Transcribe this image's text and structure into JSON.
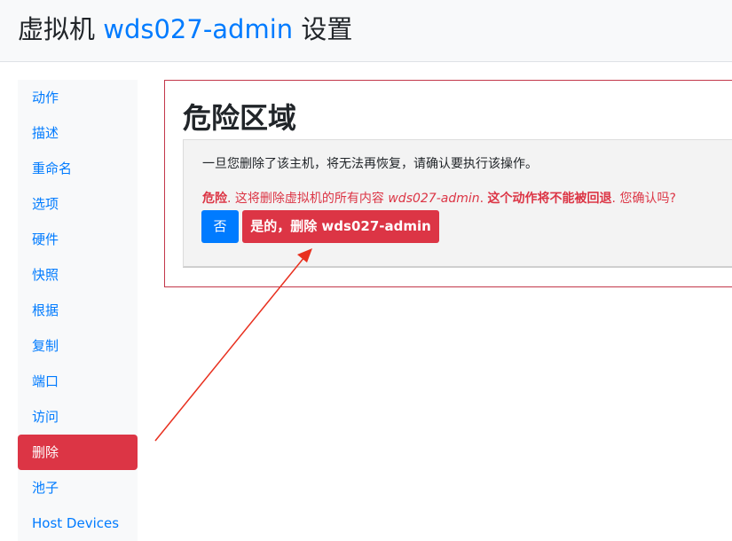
{
  "header": {
    "title_prefix": "虚拟机",
    "vm_name": "wds027-admin",
    "title_suffix": "设置"
  },
  "sidebar": {
    "items": [
      {
        "label": "动作",
        "active": false
      },
      {
        "label": "描述",
        "active": false
      },
      {
        "label": "重命名",
        "active": false
      },
      {
        "label": "选项",
        "active": false
      },
      {
        "label": "硬件",
        "active": false
      },
      {
        "label": "快照",
        "active": false
      },
      {
        "label": "根据",
        "active": false
      },
      {
        "label": "复制",
        "active": false
      },
      {
        "label": "端口",
        "active": false
      },
      {
        "label": "访问",
        "active": false
      },
      {
        "label": "删除",
        "active": true
      },
      {
        "label": "池子",
        "active": false
      },
      {
        "label": "Host Devices",
        "active": false
      }
    ]
  },
  "danger_zone": {
    "title": "危险区域",
    "message": "一旦您删除了该主机，将无法再恢复，请确认要执行该操作。",
    "warning": {
      "label": "危险",
      "text1": ". 这将删除虚拟机的所有内容 ",
      "vm_name": "wds027-admin",
      "text2": ". ",
      "emphasis": "这个动作将不能被回退",
      "text3": ". 您确认吗?"
    },
    "no_button": "否",
    "yes_button": "是的，删除 wds027-admin"
  },
  "colors": {
    "accent": "#007bff",
    "danger": "#dc3545",
    "annotation_arrow": "#e8301f"
  }
}
